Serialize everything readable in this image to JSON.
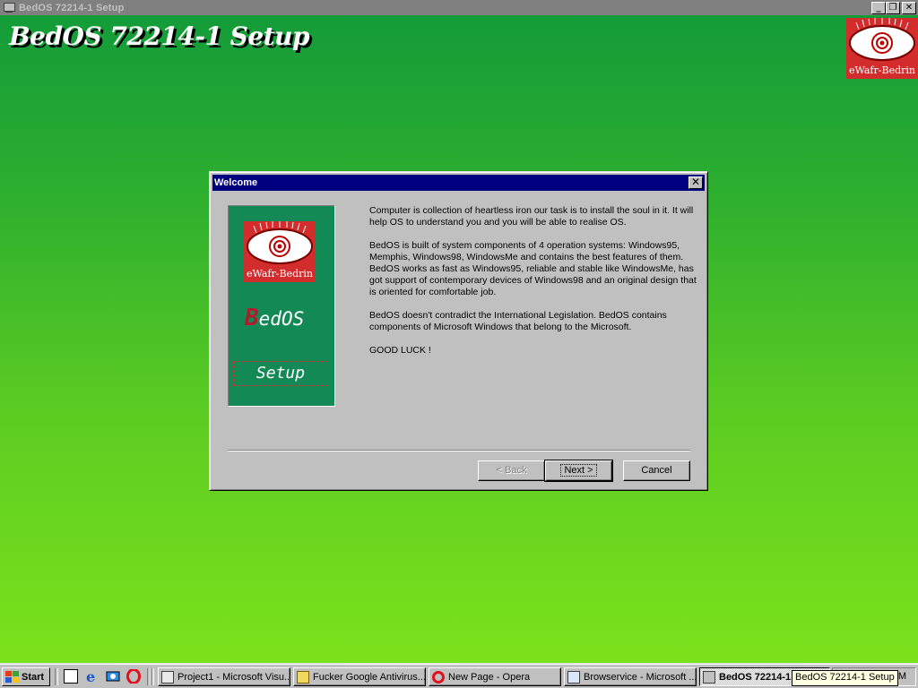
{
  "app": {
    "window_title": "BedOS 72214-1 Setup",
    "heading": "BedOS 72214-1 Setup",
    "window_controls": {
      "minimize": "_",
      "restore": "❐",
      "close": "✕"
    }
  },
  "logo": {
    "caption": "eWafr-Bedrin",
    "color": "#d22c2c"
  },
  "dialog": {
    "title": "Welcome",
    "close_glyph": "✕",
    "side_panel": {
      "logo_caption": "eWafr-Bedrin",
      "brand_first": "B",
      "brand_rest": "edOS",
      "setup_label": "Setup"
    },
    "paragraphs": [
      "Computer is collection of heartless iron our task is to install the soul in it. It will help OS to understand you and you will be able to realise OS.",
      "BedOS is built of system components of 4 operation systems: Windows95, Memphis, Windows98, WindowsMe and contains the best features of them. BedOS works as fast as Windows95, reliable and stable like WindowsMe, has got support of contemporary devices of Windows98 and an original design that is oriented for comfortable job.",
      "BedOS doesn't contradict the International Legislation. BedOS contains components of Microsoft Windows that belong to the Microsoft.",
      "GOOD LUCK !"
    ],
    "buttons": {
      "back": "< Back",
      "next": "Next >",
      "cancel": "Cancel"
    }
  },
  "taskbar": {
    "start_label": "Start",
    "quick_launch": [
      "desktop-icon",
      "internet-explorer-icon",
      "channels-icon",
      "opera-icon"
    ],
    "tasks": [
      {
        "label": "Project1 - Microsoft Visu...",
        "icon": "vb-icon"
      },
      {
        "label": "Fucker Google Antivirus...",
        "icon": "folder-icon"
      },
      {
        "label": "New Page - Opera",
        "icon": "opera-icon"
      },
      {
        "label": "Browservice - Microsoft ...",
        "icon": "ie-icon"
      },
      {
        "label": "BedOS 72214-1 Setup",
        "icon": "setup-icon"
      }
    ],
    "clock": "AM",
    "tooltip": "BedOS 72214-1 Setup"
  }
}
